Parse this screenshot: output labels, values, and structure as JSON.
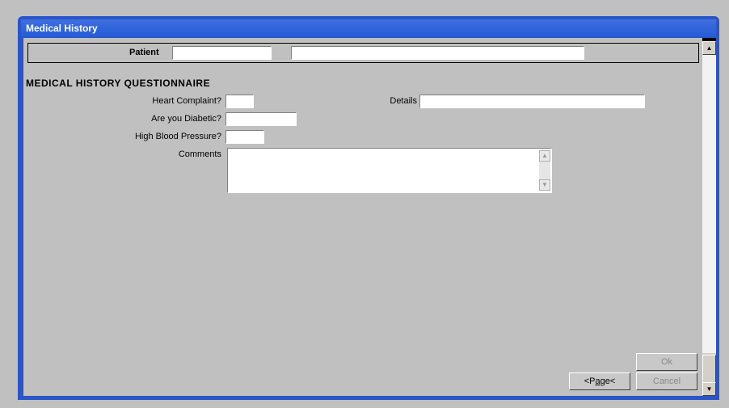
{
  "window": {
    "title": "Medical History"
  },
  "patient_bar": {
    "label": "Patient",
    "patient_id_value": "",
    "patient_name_value": ""
  },
  "questionnaire": {
    "heading": "MEDICAL HISTORY QUESTIONNAIRE",
    "heart_complaint_label": "Heart Complaint?",
    "heart_complaint_value": "",
    "details_label": "Details",
    "details_value": "",
    "diabetic_label": "Are you Diabetic?",
    "diabetic_value": "",
    "blood_pressure_label": "High Blood Pressure?",
    "blood_pressure_value": "",
    "comments_label": "Comments",
    "comments_value": ""
  },
  "buttons": {
    "page_prefix": "<P",
    "page_underlined": "a",
    "page_suffix": "ge<",
    "ok": "Ok",
    "cancel": "Cancel"
  },
  "icons": {
    "scroll_up": "scroll-up-arrow-icon",
    "scroll_down": "scroll-down-arrow-icon"
  }
}
